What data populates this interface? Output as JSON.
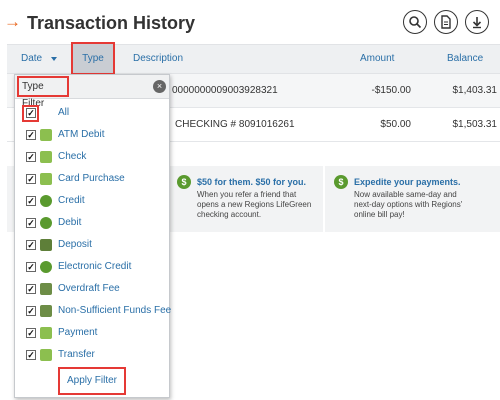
{
  "header": {
    "title": "Transaction History",
    "icons": [
      "search-icon",
      "document-icon",
      "download-icon"
    ]
  },
  "table": {
    "columns": {
      "date": "Date",
      "type": "Type",
      "description": "Description",
      "amount": "Amount",
      "balance": "Balance"
    },
    "rows": [
      {
        "description": "0000000009003928321",
        "amount": "-$150.00",
        "balance": "$1,403.31"
      },
      {
        "description": "CHECKING # 8091016261",
        "amount": "$50.00",
        "balance": "$1,503.31"
      }
    ]
  },
  "promos": [
    {
      "title": "$50 for them. $50 for you.",
      "text_line1": "When you refer a friend that",
      "text_line2": "opens a new Regions LifeGreen",
      "text_line3": "checking account."
    },
    {
      "title": "Expedite your payments.",
      "text_line1": "Now available same-day and",
      "text_line2": "next-day options with Regions'",
      "text_line3": "online bill pay!"
    }
  ],
  "filter": {
    "title": "Type Filter",
    "close_icon": "close-icon",
    "items": [
      {
        "label": "All",
        "checked": true,
        "icon": ""
      },
      {
        "label": "ATM Debit",
        "checked": true,
        "icon": "atm-card-icon"
      },
      {
        "label": "Check",
        "checked": true,
        "icon": "check-icon"
      },
      {
        "label": "Card Purchase",
        "checked": true,
        "icon": "card-icon"
      },
      {
        "label": "Credit",
        "checked": true,
        "icon": "dollar-icon"
      },
      {
        "label": "Debit",
        "checked": true,
        "icon": "dollar-icon"
      },
      {
        "label": "Deposit",
        "checked": true,
        "icon": "piggy-bank-icon"
      },
      {
        "label": "Electronic Credit",
        "checked": true,
        "icon": "dollar-icon"
      },
      {
        "label": "Overdraft Fee",
        "checked": true,
        "icon": "bank-icon"
      },
      {
        "label": "Non-Sufficient Funds Fee",
        "checked": true,
        "icon": "bank-icon"
      },
      {
        "label": "Payment",
        "checked": true,
        "icon": "payment-icon"
      },
      {
        "label": "Transfer",
        "checked": true,
        "icon": "transfer-icon"
      }
    ],
    "apply_label": "Apply Filter"
  },
  "colors": {
    "accent": "#e8641b",
    "link": "#2a6fa7",
    "highlight": "#e53935",
    "green": "#5a9a2e"
  }
}
